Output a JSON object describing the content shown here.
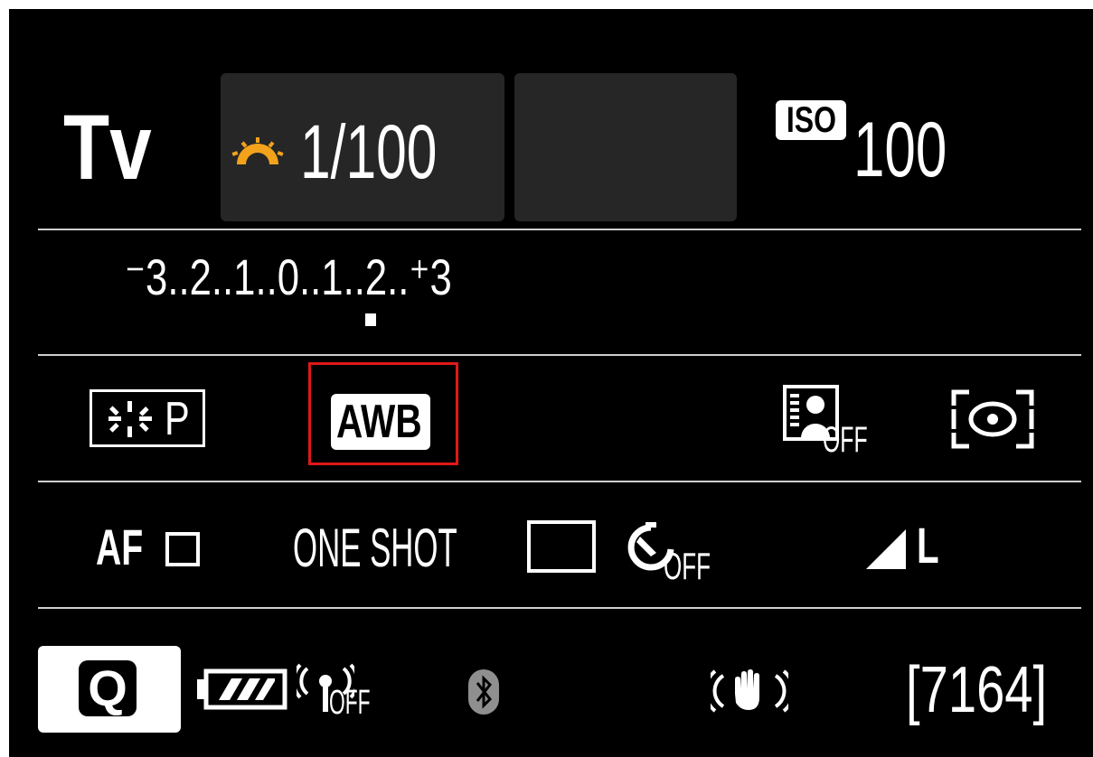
{
  "mode": "Tv",
  "shutter": {
    "value": "1/100",
    "icon": "shutter-priority-dial-icon",
    "icon_color": "#f2a31b"
  },
  "iso": {
    "badge": "ISO",
    "value": "100"
  },
  "exposure_scale": {
    "labels": [
      "-3",
      "2",
      "1",
      "0",
      "1",
      "2",
      "+3"
    ],
    "text": "⁻3..2..1..0..1..2..⁺3",
    "current_value": 0
  },
  "settings_row1": {
    "picture_style": {
      "label": "P",
      "icon": "picture-style-icon"
    },
    "white_balance": {
      "label": "AWB",
      "selected": true,
      "selection_color": "#e01818"
    },
    "auto_lighting_optimizer": {
      "label": "OFF",
      "icon": "auto-lighting-optimizer-icon"
    },
    "metering": {
      "icon": "evaluative-metering-icon"
    }
  },
  "settings_row2": {
    "af_label": "AF",
    "af_area_icon": "single-point-af-icon",
    "af_operation": "ONE SHOT",
    "drive_icon": "single-shooting-icon",
    "self_timer": {
      "label": "OFF",
      "icon": "self-timer-icon"
    },
    "image_quality": {
      "label": "L",
      "icon": "fine-quality-icon"
    }
  },
  "status_bar": {
    "q_button": "Q",
    "battery_icon": "battery-full-icon",
    "wifi": {
      "label": "OFF",
      "icon": "wifi-icon"
    },
    "bluetooth_icon": "bluetooth-icon",
    "stabilizer_icon": "image-stabilizer-icon",
    "shots_remaining": "[7164]"
  }
}
